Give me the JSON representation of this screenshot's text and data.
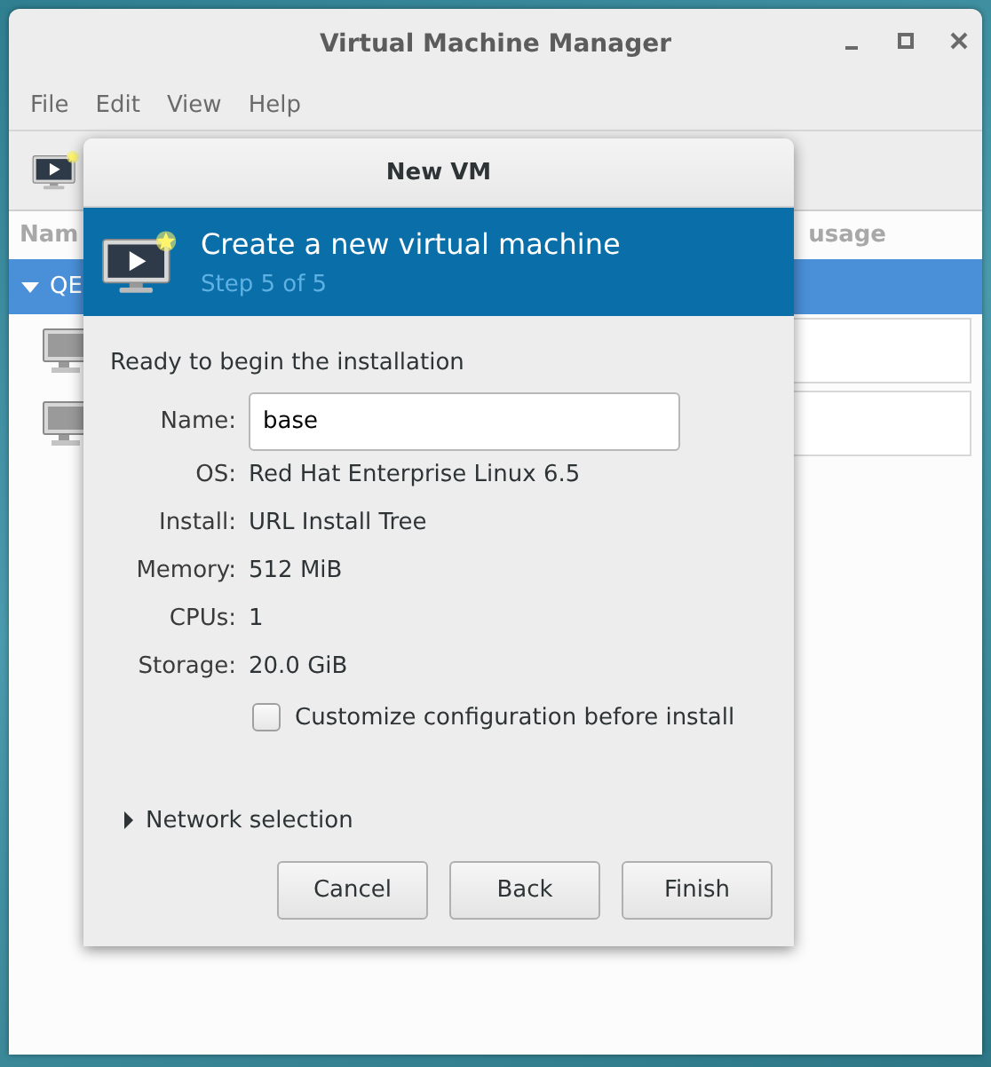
{
  "window": {
    "title": "Virtual Machine Manager",
    "menu": [
      "File",
      "Edit",
      "View",
      "Help"
    ],
    "list": {
      "columns": [
        "Nam",
        "usage"
      ],
      "groups": [
        {
          "label": "QE",
          "expanded": true,
          "selected": true
        }
      ],
      "rows": [
        {
          "kind": "vm"
        },
        {
          "kind": "vm"
        }
      ]
    }
  },
  "dialog": {
    "title": "New VM",
    "header": {
      "title": "Create a new virtual machine",
      "step": "Step 5 of 5"
    },
    "intro": "Ready to begin the installation",
    "fields": [
      {
        "label": "Name:",
        "kind": "entry",
        "value": "base"
      },
      {
        "label": "OS:",
        "kind": "text",
        "value": "Red Hat Enterprise Linux 6.5"
      },
      {
        "label": "Install:",
        "kind": "text",
        "value": "URL Install Tree"
      },
      {
        "label": "Memory:",
        "kind": "text",
        "value": "512 MiB"
      },
      {
        "label": "CPUs:",
        "kind": "text",
        "value": "1"
      },
      {
        "label": "Storage:",
        "kind": "text",
        "value": "20.0 GiB"
      }
    ],
    "checkbox": {
      "label": "Customize configuration before install",
      "checked": false
    },
    "expander": {
      "label": "Network selection",
      "expanded": false
    },
    "buttons": [
      "Cancel",
      "Back",
      "Finish"
    ]
  }
}
